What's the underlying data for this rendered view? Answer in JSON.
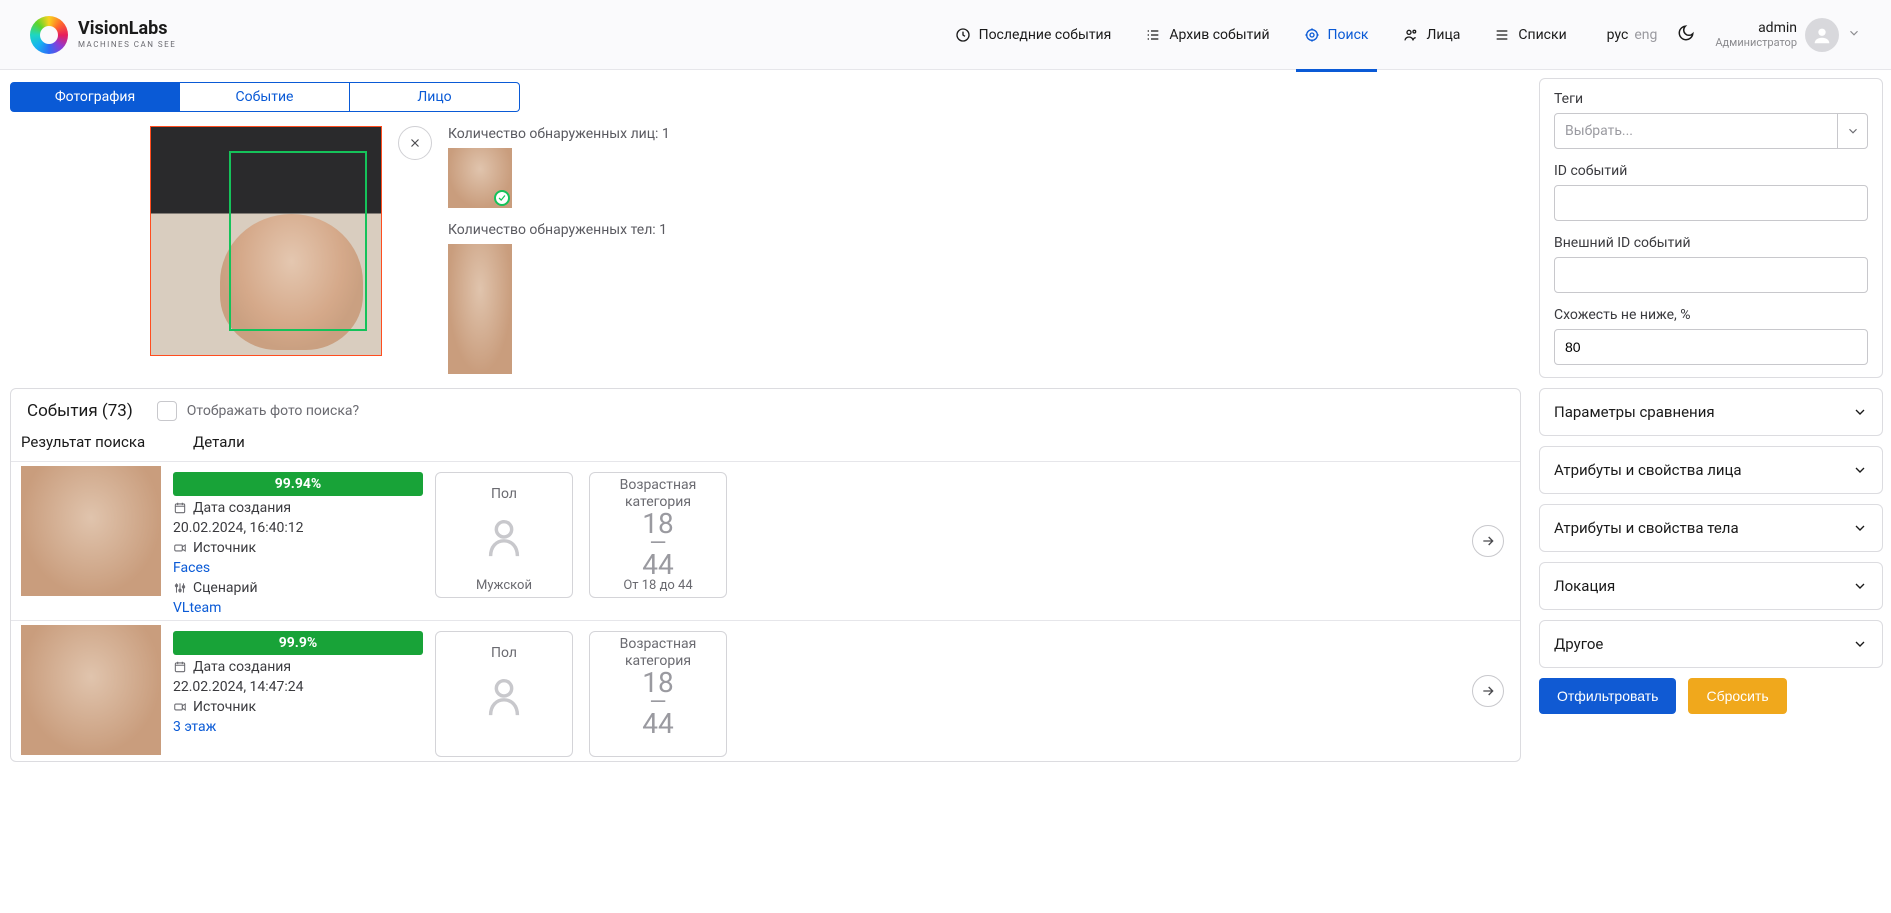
{
  "brand": {
    "name": "VisionLabs",
    "tagline": "MACHINES CAN SEE"
  },
  "nav": {
    "recent": "Последние события",
    "archive": "Архив событий",
    "search": "Поиск",
    "faces": "Лица",
    "lists": "Списки"
  },
  "lang": {
    "ru": "рус",
    "en": "eng"
  },
  "user": {
    "name": "admin",
    "role": "Администратор"
  },
  "source_tabs": {
    "photo": "Фотография",
    "event": "Событие",
    "face": "Лицо"
  },
  "detected": {
    "faces_label": "Количество обнаруженных лиц: 1",
    "bodies_label": "Количество обнаруженных тел: 1"
  },
  "results_header": {
    "title": "События (73)",
    "show_search_photo": "Отображать фото поиска?",
    "col_result": "Результат поиска",
    "col_details": "Детали"
  },
  "rows": [
    {
      "score": "99.94%",
      "date_label": "Дата создания",
      "date": "20.02.2024, 16:40:12",
      "source_label": "Источник",
      "source": "Faces",
      "scenario_label": "Сценарий",
      "scenario": "VLteam",
      "gender_title": "Пол",
      "gender_value": "Мужской",
      "age_title": "Возрастная категория",
      "age_top": "18",
      "age_bottom": "44",
      "age_foot": "От 18 до 44"
    },
    {
      "score": "99.9%",
      "date_label": "Дата создания",
      "date": "22.02.2024, 14:47:24",
      "source_label": "Источник",
      "source": "3 этаж",
      "scenario_label": "",
      "scenario": "",
      "gender_title": "Пол",
      "gender_value": "",
      "age_title": "Возрастная категория",
      "age_top": "18",
      "age_bottom": "44",
      "age_foot": ""
    }
  ],
  "filters": {
    "tags_label": "Теги",
    "tags_placeholder": "Выбрать...",
    "event_ids_label": "ID событий",
    "ext_event_ids_label": "Внешний ID событий",
    "sim_label": "Схожесть не ниже, %",
    "sim_value": "80"
  },
  "accordions": {
    "compare": "Параметры сравнения",
    "face": "Атрибуты и свойства лица",
    "body": "Атрибуты и свойства тела",
    "loc": "Локация",
    "other": "Другое"
  },
  "actions": {
    "apply": "Отфильтровать",
    "reset": "Сбросить"
  }
}
